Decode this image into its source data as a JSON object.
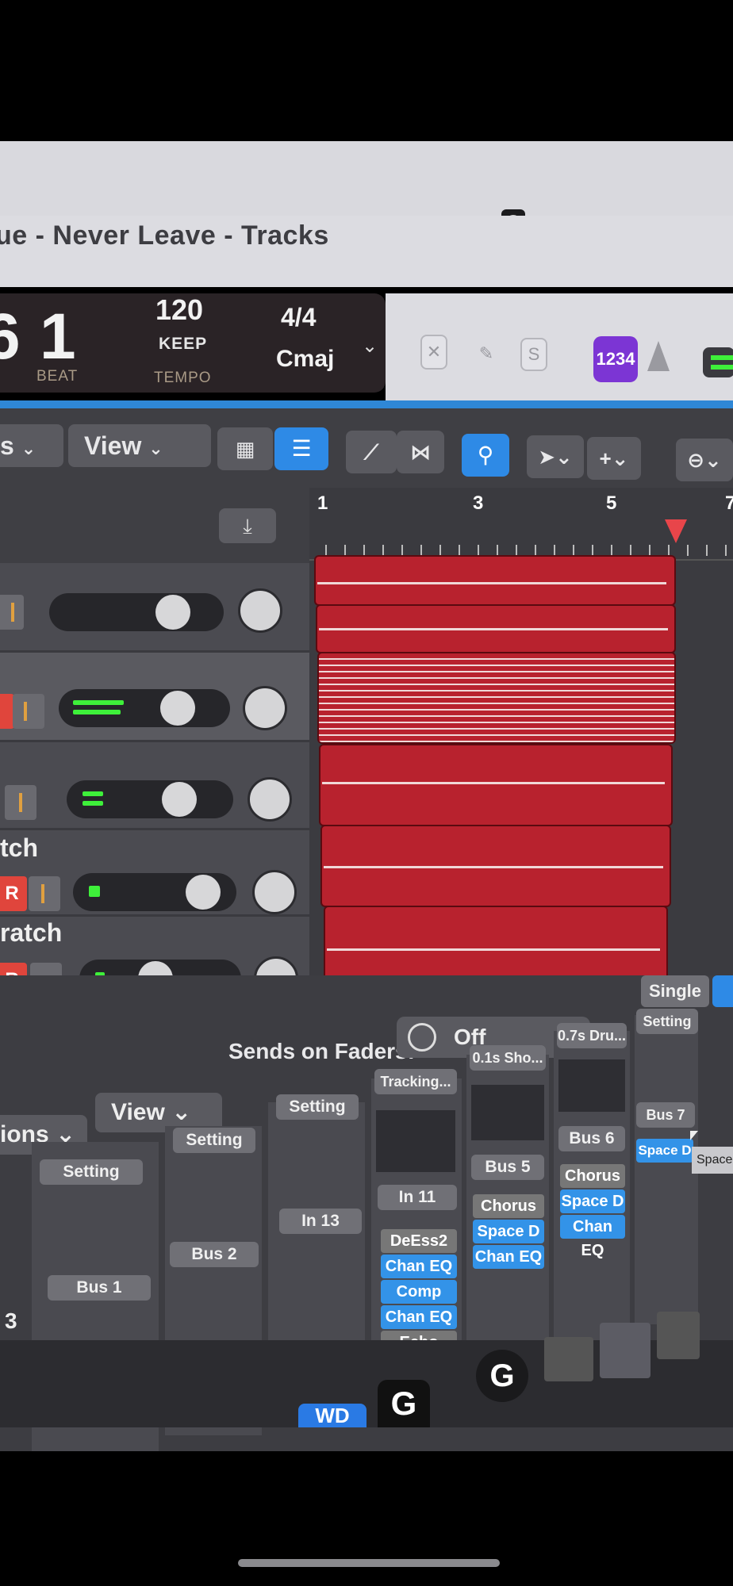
{
  "window": {
    "title": "ue - Never Leave  - Tracks"
  },
  "lcd": {
    "big_left": "6",
    "beat_value": "1",
    "beat_label": "BEAT",
    "tempo_value": "120",
    "tempo_keep": "KEEP",
    "tempo_label": "TEMPO",
    "signature": "4/4",
    "key": "Cmaj"
  },
  "control_bar": {
    "count_in_label": "1234",
    "solo_label": "S"
  },
  "toolbar": {
    "menu_left": "s",
    "view_label": "View"
  },
  "ruler": {
    "bars": [
      "1",
      "3",
      "5",
      "7"
    ]
  },
  "tracks": [
    {
      "name": ""
    },
    {
      "name": ""
    },
    {
      "name": ""
    },
    {
      "name": "tch",
      "record": "R"
    },
    {
      "name": "ratch",
      "record": "R"
    }
  ],
  "mixer": {
    "single_label": "Single",
    "sends_label": "Sends on Faders:",
    "sends_value": "Off",
    "view_label": "View",
    "options_label": "ions",
    "setting_label": "Setting",
    "strip_names": [
      "Tracking...",
      "0.1s Sho...",
      "0.7s Dru..."
    ],
    "bus_labels": [
      "Bus 1",
      "Bus 2",
      "Bus 5",
      "Bus 6",
      "Bus 7"
    ],
    "input_labels": [
      "In 11",
      "In 13"
    ],
    "left_num": "3",
    "plugins_a": [
      "DeEss2",
      "Chan EQ",
      "Comp",
      "Chan EQ",
      "Echo"
    ],
    "plugins_b": [
      "Chorus",
      "Space D",
      "Chan EQ"
    ],
    "plugins_c": [
      "Chorus",
      "Space D",
      "Chan EQ"
    ],
    "plugins_d": [
      "Space D"
    ],
    "tooltip": "Space"
  },
  "colors": {
    "accent": "#2e8ae6",
    "region": "#b8222e",
    "record": "#e0453c",
    "purple": "#7c35d4"
  }
}
